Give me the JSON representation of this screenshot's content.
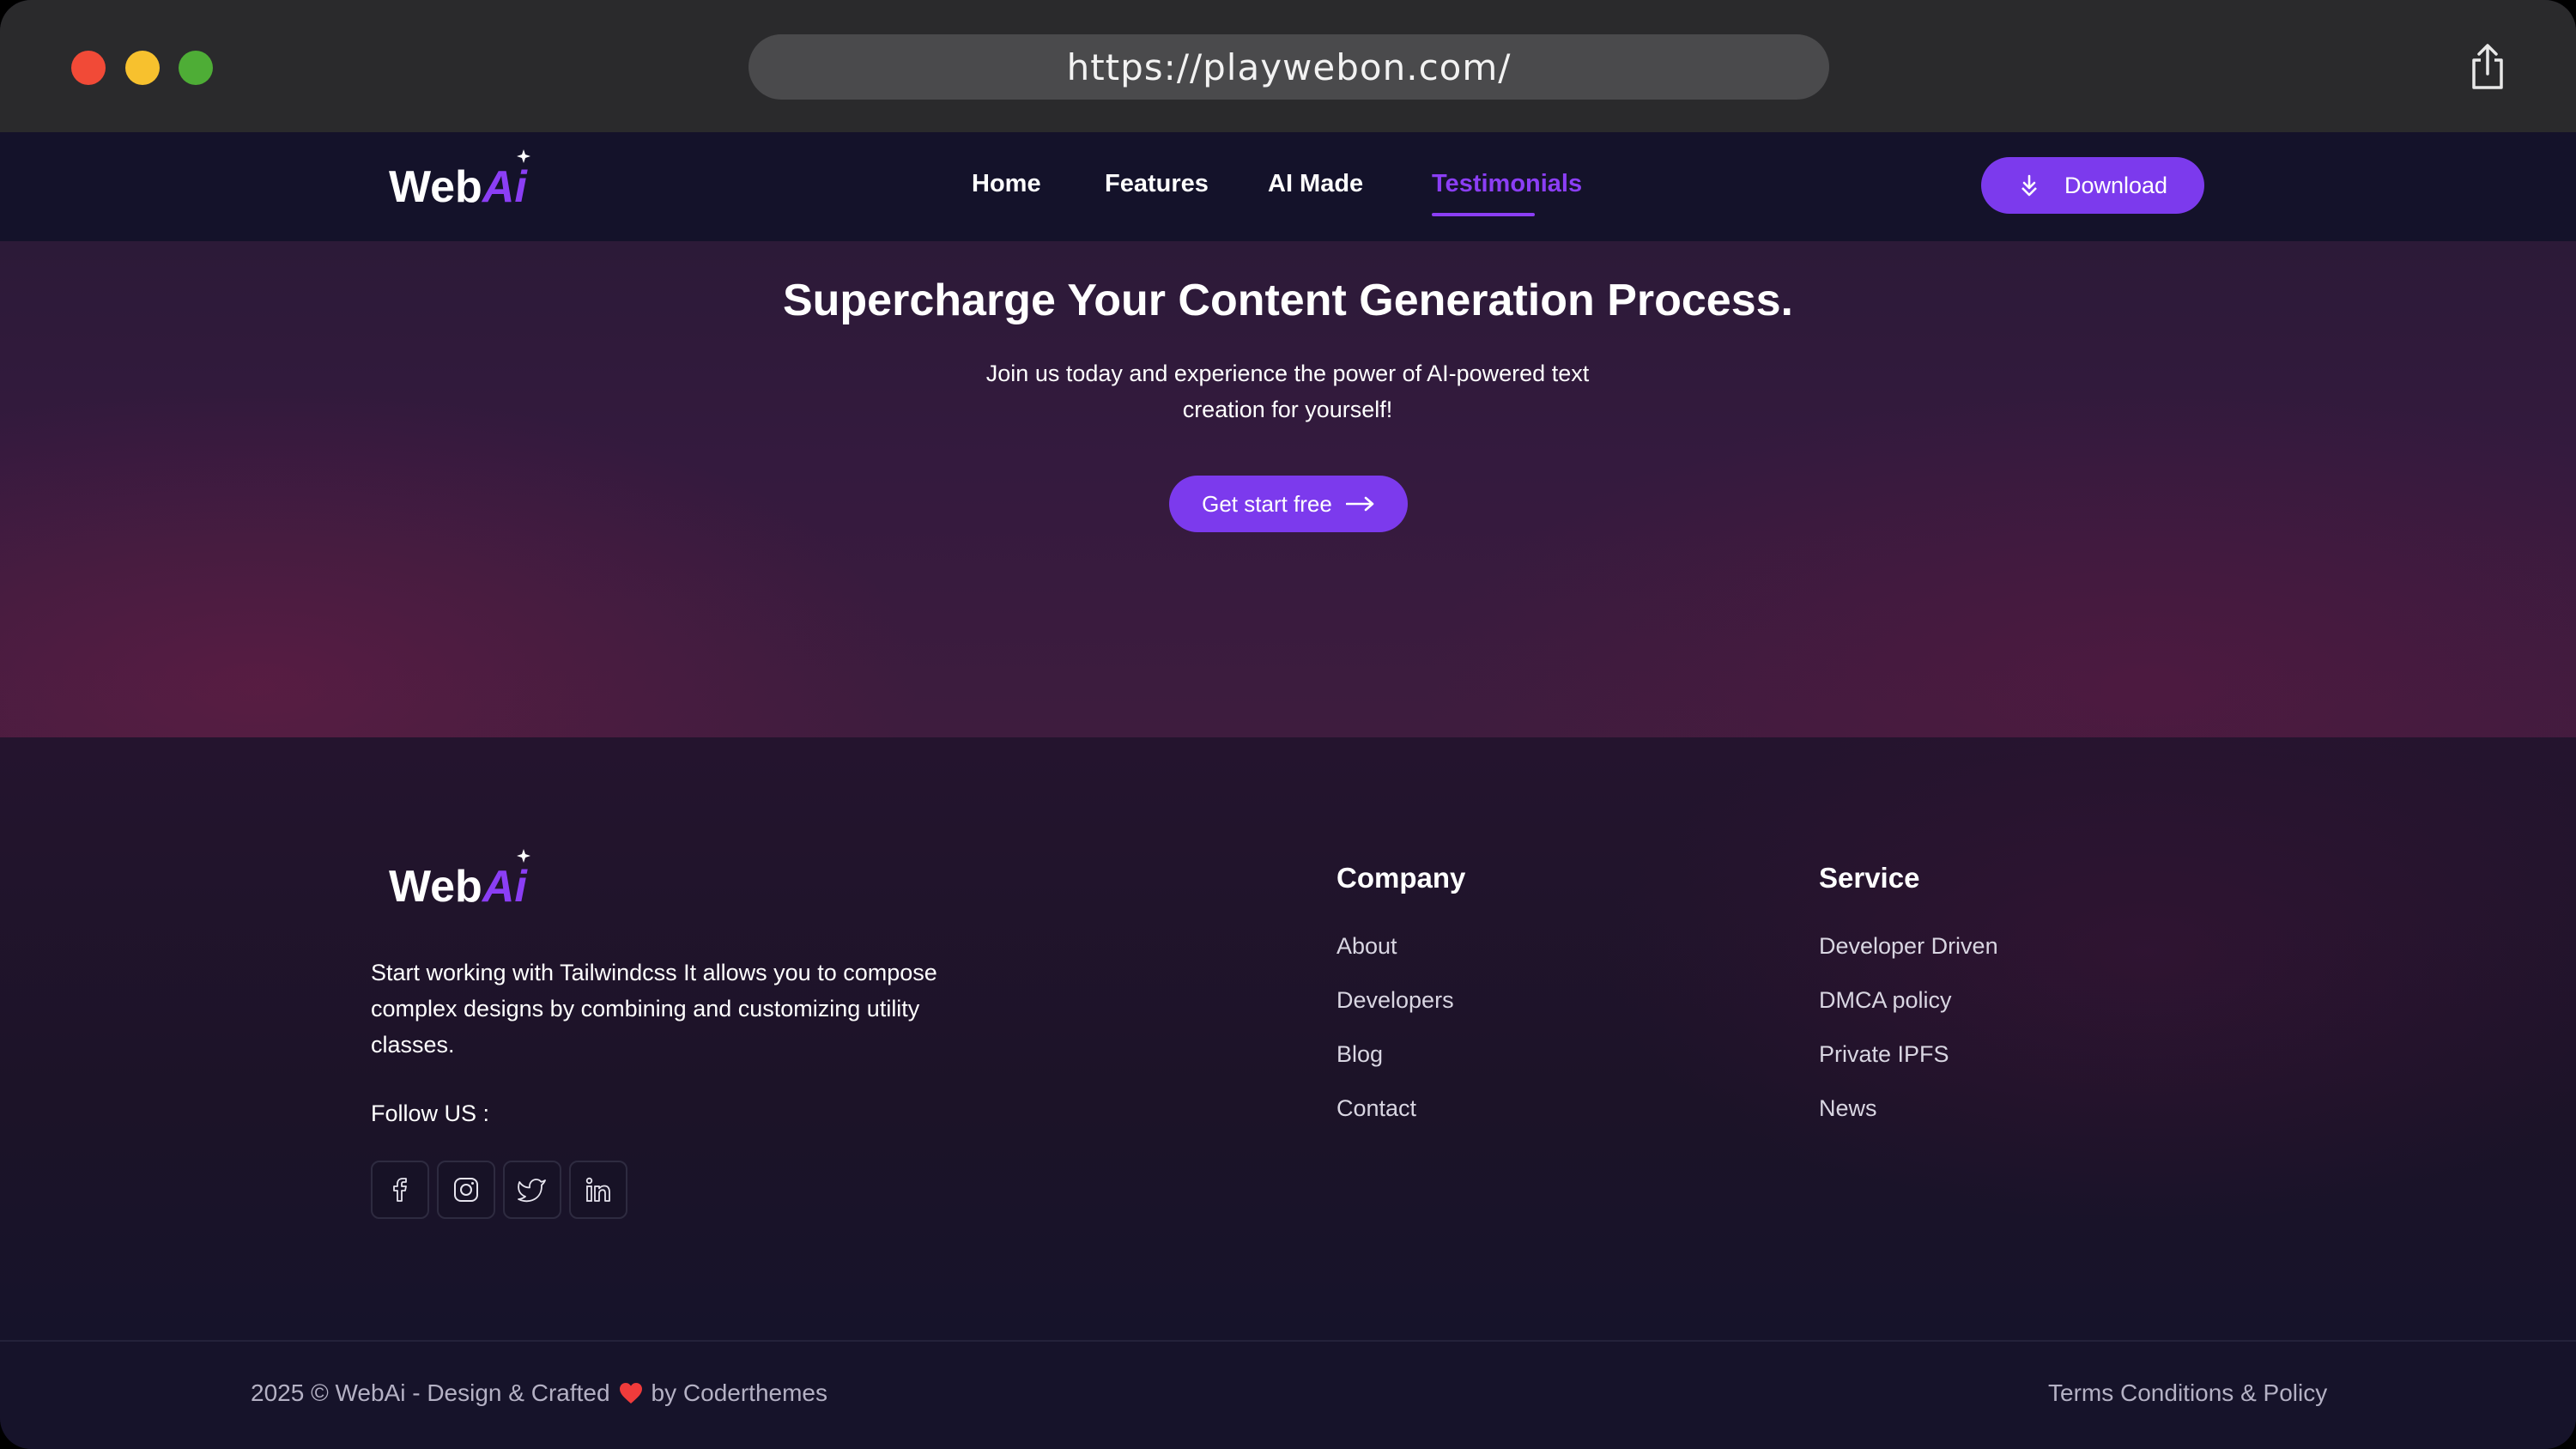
{
  "browser": {
    "url": "https://playwebon.com/"
  },
  "brand": {
    "logo_text_main": "Web",
    "logo_text_accent": "Ai",
    "accent_color": "#8b3ef5"
  },
  "nav": {
    "links": [
      {
        "label": "Home",
        "active": false
      },
      {
        "label": "Features",
        "active": false
      },
      {
        "label": "AI Made",
        "active": false
      },
      {
        "label": "Testimonials",
        "active": true
      }
    ],
    "download_label": "Download",
    "download_icon": "download-icon"
  },
  "hero": {
    "title": "Supercharge Your Content Generation Process.",
    "subtitle_line1": "Join us today and experience the power of AI-powered text",
    "subtitle_line2": "creation for yourself!",
    "cta_label": "Get start free",
    "cta_icon": "arrow-right-icon"
  },
  "footer": {
    "description": "Start working with Tailwindcss It allows you to compose complex designs by combining and customizing utility classes.",
    "follow_label": "Follow US :",
    "socials": [
      "facebook-icon",
      "instagram-icon",
      "twitter-icon",
      "linkedin-icon"
    ],
    "company": {
      "title": "Company",
      "links": [
        "About",
        "Developers",
        "Blog",
        "Contact"
      ]
    },
    "service": {
      "title": "Service",
      "links": [
        "Developer Driven",
        "DMCA policy",
        "Private IPFS",
        "News"
      ]
    },
    "copyright_before": "2025 © WebAi - Design & Crafted",
    "copyright_after": "by Coderthemes",
    "terms": "Terms Conditions & Policy"
  }
}
